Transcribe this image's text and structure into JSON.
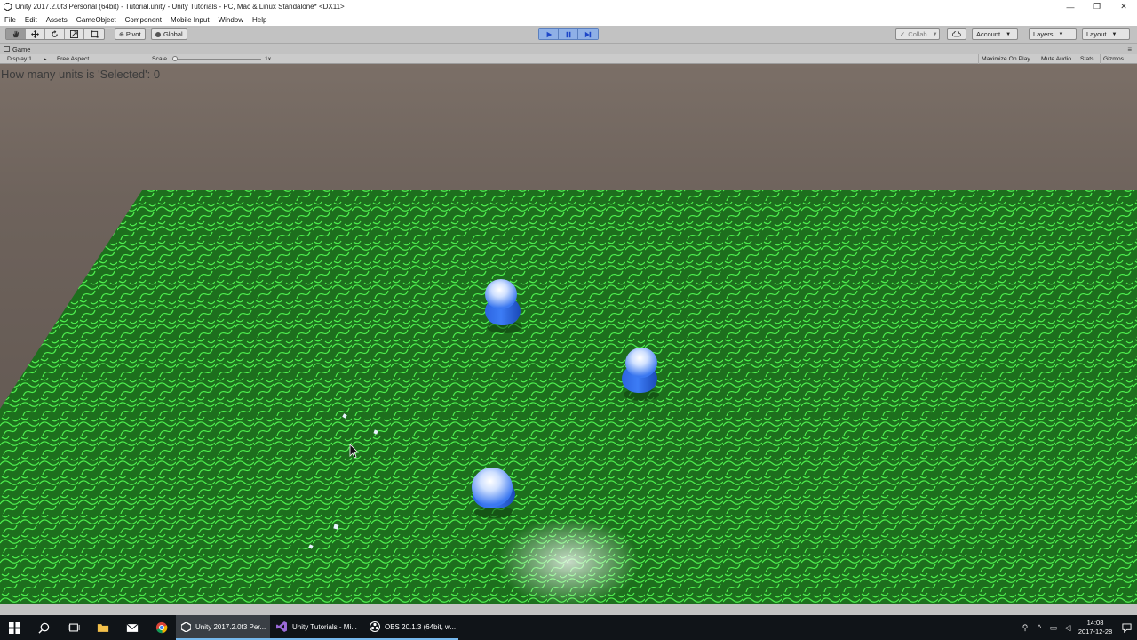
{
  "window": {
    "title": "Unity 2017.2.0f3 Personal (64bit) - Tutorial.unity - Unity Tutorials - PC, Mac & Linux Standalone* <DX11>",
    "minimize": "—",
    "maximize": "❐",
    "close": "✕"
  },
  "menu": [
    "File",
    "Edit",
    "Assets",
    "GameObject",
    "Component",
    "Mobile Input",
    "Window",
    "Help"
  ],
  "toolbar": {
    "pivot_label": "Pivot",
    "global_label": "Global",
    "collab_label": "Collab",
    "account_label": "Account",
    "layers_label": "Layers",
    "layout_label": "Layout"
  },
  "game_panel": {
    "tab_label": "Game",
    "display_label": "Display 1",
    "aspect_label": "Free Aspect",
    "scale_label": "Scale",
    "scale_value": "1x",
    "maximize_label": "Maximize On Play",
    "mute_label": "Mute Audio",
    "stats_label": "Stats",
    "gizmos_label": "Gizmos"
  },
  "hud": {
    "selected_text": "How many units is 'Selected': 0"
  },
  "taskbar": {
    "apps": [
      {
        "label": "Unity 2017.2.0f3 Per...",
        "active": true
      },
      {
        "label": "Unity Tutorials - Mi...",
        "active": false
      },
      {
        "label": "OBS 20.1.3 (64bit, w...",
        "active": false
      }
    ],
    "time": "14:08",
    "date": "2017-12-28"
  },
  "colors": {
    "ground": "#1f7a1f",
    "ground_lines": "#4be84b",
    "unit_blue": "#2f6fe6",
    "sky": "#766a62"
  }
}
